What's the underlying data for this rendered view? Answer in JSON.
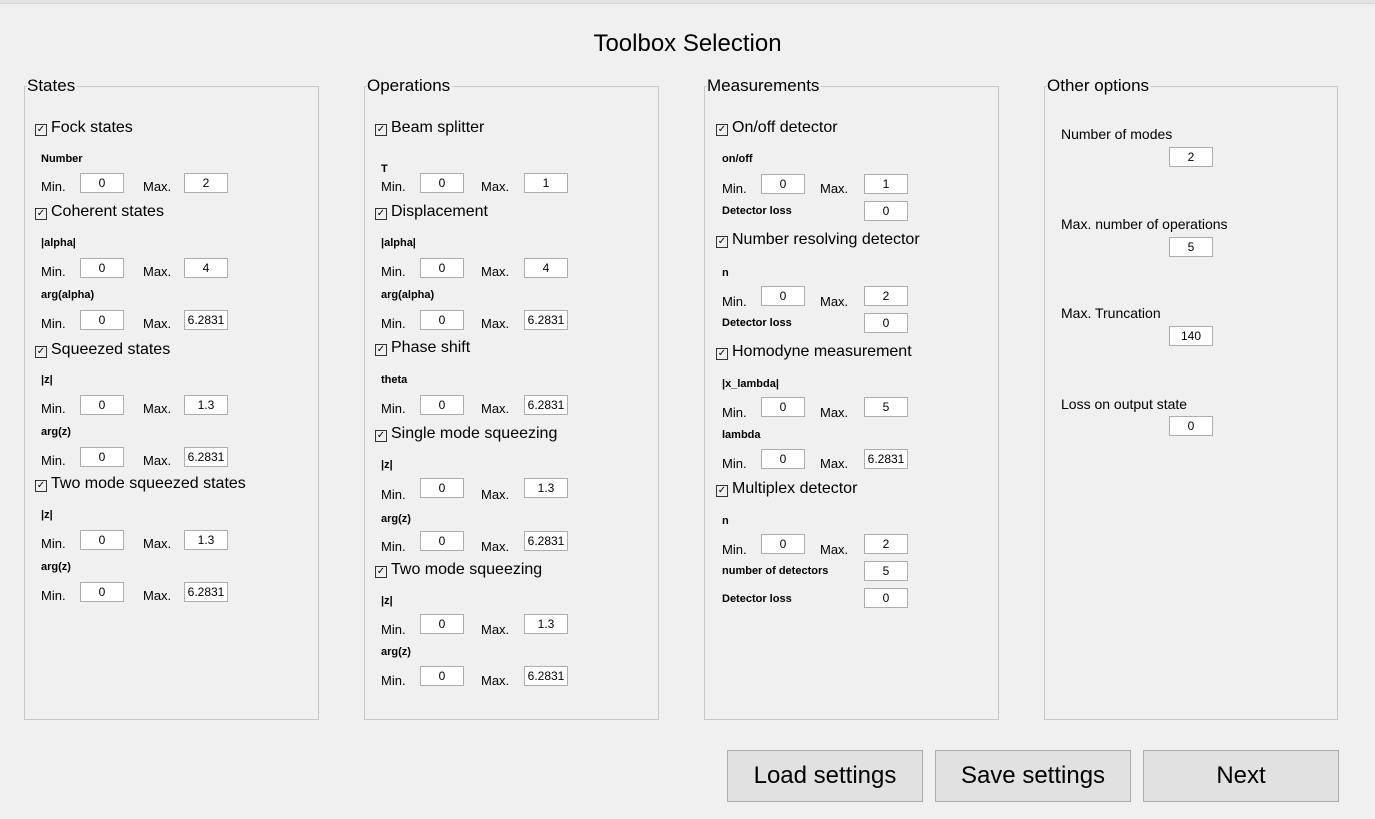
{
  "title": "Toolbox Selection",
  "states": {
    "legend": "States",
    "fock": "Fock states",
    "fock_sub": "Number",
    "fock_min": "0",
    "fock_max": "2",
    "coherent": "Coherent states",
    "coh_abs": "|alpha|",
    "coh_abs_min": "0",
    "coh_abs_max": "4",
    "coh_arg": "arg(alpha)",
    "coh_arg_min": "0",
    "coh_arg_max": "6.2831",
    "squeezed": "Squeezed states",
    "sq_abs": "|z|",
    "sq_abs_min": "0",
    "sq_abs_max": "1.3",
    "sq_arg": "arg(z)",
    "sq_arg_min": "0",
    "sq_arg_max": "6.2831",
    "twomode": "Two mode squeezed states",
    "tm_abs": "|z|",
    "tm_abs_min": "0",
    "tm_abs_max": "1.3",
    "tm_arg": "arg(z)",
    "tm_arg_min": "0",
    "tm_arg_max": "6.2831"
  },
  "operations": {
    "legend": "Operations",
    "bs": "Beam splitter",
    "bs_sub": "T",
    "bs_min": "0",
    "bs_max": "1",
    "disp": "Displacement",
    "disp_abs": "|alpha|",
    "disp_abs_min": "0",
    "disp_abs_max": "4",
    "disp_arg": "arg(alpha)",
    "disp_arg_min": "0",
    "disp_arg_max": "6.2831",
    "phase": "Phase shift",
    "phase_sub": "theta",
    "phase_min": "0",
    "phase_max": "6.2831",
    "sms": "Single mode squeezing",
    "sms_abs": "|z|",
    "sms_abs_min": "0",
    "sms_abs_max": "1.3",
    "sms_arg": "arg(z)",
    "sms_arg_min": "0",
    "sms_arg_max": "6.2831",
    "tms": "Two mode squeezing",
    "tms_abs": "|z|",
    "tms_abs_min": "0",
    "tms_abs_max": "1.3",
    "tms_arg": "arg(z)",
    "tms_arg_min": "0",
    "tms_arg_max": "6.2831"
  },
  "measurements": {
    "legend": "Measurements",
    "onoff": "On/off detector",
    "onoff_sub": "on/off",
    "onoff_min": "0",
    "onoff_max": "1",
    "onoff_loss_label": "Detector loss",
    "onoff_loss": "0",
    "nrd": "Number resolving detector",
    "nrd_sub": "n",
    "nrd_min": "0",
    "nrd_max": "2",
    "nrd_loss_label": "Detector loss",
    "nrd_loss": "0",
    "hom": "Homodyne measurement",
    "hom_x": "|x_lambda|",
    "hom_x_min": "0",
    "hom_x_max": "5",
    "hom_l": "lambda",
    "hom_l_min": "0",
    "hom_l_max": "6.2831",
    "mpx": "Multiplex detector",
    "mpx_sub": "n",
    "mpx_min": "0",
    "mpx_max": "2",
    "mpx_num_label": "number of detectors",
    "mpx_num": "5",
    "mpx_loss_label": "Detector loss",
    "mpx_loss": "0"
  },
  "other": {
    "legend": "Other options",
    "modes_label": "Number of modes",
    "modes": "2",
    "ops_label": "Max. number of operations",
    "ops": "5",
    "trunc_label": "Max. Truncation",
    "trunc": "140",
    "loss_label": "Loss on output state",
    "loss": "0"
  },
  "labels": {
    "min": "Min.",
    "max": "Max.",
    "check": "✓"
  },
  "buttons": {
    "load": "Load settings",
    "save": "Save settings",
    "next": "Next"
  }
}
